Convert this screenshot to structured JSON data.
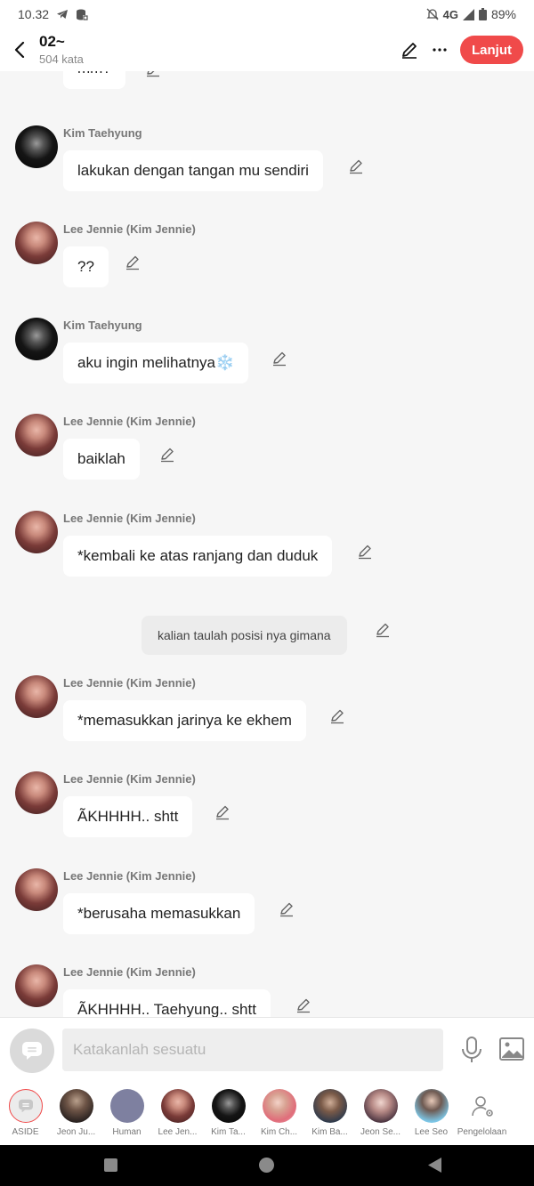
{
  "status": {
    "time": "10.32",
    "network": "4G",
    "battery": "89%"
  },
  "header": {
    "title": "02~",
    "subtitle": "504 kata",
    "next_label": "Lanjut"
  },
  "messages": [
    {
      "sender": "",
      "text": "mm?"
    },
    {
      "sender": "Kim Taehyung",
      "text": "lakukan dengan tangan mu sendiri"
    },
    {
      "sender": "Lee Jennie (Kim Jennie)",
      "text": "??"
    },
    {
      "sender": "Kim Taehyung",
      "text": "aku ingin melihatnya❄️"
    },
    {
      "sender": "Lee Jennie (Kim Jennie)",
      "text": "baiklah"
    },
    {
      "sender": "Lee Jennie (Kim Jennie)",
      "text": "*kembali ke atas ranjang dan duduk"
    },
    {
      "sender": "",
      "text": "kalian taulah posisi nya gimana"
    },
    {
      "sender": "Lee Jennie (Kim Jennie)",
      "text": "*memasukkan jarinya ke ekhem"
    },
    {
      "sender": "Lee Jennie (Kim Jennie)",
      "text": "ÃKHHHH.. shtt"
    },
    {
      "sender": "Lee Jennie (Kim Jennie)",
      "text": "*berusaha memasukkan"
    },
    {
      "sender": "Lee Jennie (Kim Jennie)",
      "text": "ÃKHHHH.. Taehyung.. shtt"
    }
  ],
  "input": {
    "placeholder": "Katakanlah sesuatu"
  },
  "characters": [
    {
      "label": "ASIDE"
    },
    {
      "label": "Jeon Ju..."
    },
    {
      "label": "Human"
    },
    {
      "label": "Lee Jen..."
    },
    {
      "label": "Kim Ta..."
    },
    {
      "label": "Kim Ch..."
    },
    {
      "label": "Kim Ba..."
    },
    {
      "label": "Jeon Se..."
    },
    {
      "label": "Lee Seo"
    },
    {
      "label": "Pengelolaan"
    }
  ],
  "colors": {
    "accent": "#f04a4a",
    "bubble": "#ffffff",
    "background": "#f6f6f6"
  }
}
